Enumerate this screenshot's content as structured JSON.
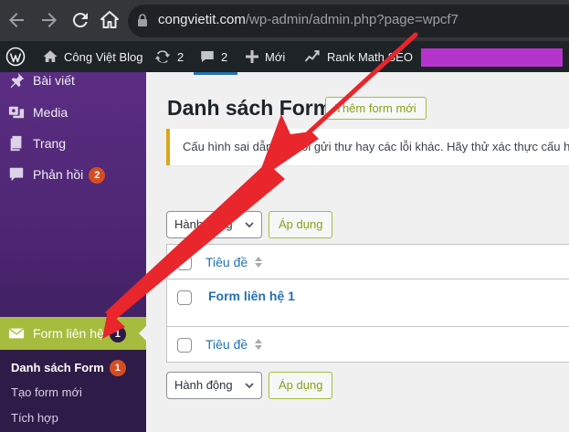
{
  "browser": {
    "url_domain": "congvietit.com",
    "url_path": "/wp-admin/admin.php?page=wpcf7"
  },
  "adminbar": {
    "site_name": "Công Việt Blog",
    "updates_count": "2",
    "comments_count": "2",
    "new_label": "Mới",
    "rank_math_label": "Rank Math SEO"
  },
  "sidebar": {
    "items": [
      {
        "label": "Bài viết",
        "icon": "pin-icon"
      },
      {
        "label": "Media",
        "icon": "media-icon"
      },
      {
        "label": "Trang",
        "icon": "pages-icon"
      },
      {
        "label": "Phản hồi",
        "icon": "comment-icon",
        "badge": "2"
      }
    ],
    "forms": {
      "label": "Form liên hệ",
      "badge": "1",
      "icon": "envelope-icon"
    },
    "submenu": [
      {
        "label": "Danh sách Form",
        "badge": "1",
        "current": true
      },
      {
        "label": "Tạo form mới"
      },
      {
        "label": "Tích hợp"
      }
    ]
  },
  "main": {
    "title": "Danh sách Form",
    "add_new": "Thêm form mới",
    "notice": "Cấu hình sai dẫn đến lỗi gửi thư hay các lỗi khác. Hãy thử xác thực cấu hình",
    "bulk_action": "Hành động",
    "apply": "Áp dụng",
    "column_title": "Tiêu đề",
    "rows": [
      {
        "title": "Form liên hệ 1"
      }
    ]
  },
  "colors": {
    "accent": "#a6bc3e",
    "sidebar_top": "#5b2d83",
    "link": "#2271b1",
    "arrow": "#e8262c",
    "mask": "#b535cc"
  }
}
